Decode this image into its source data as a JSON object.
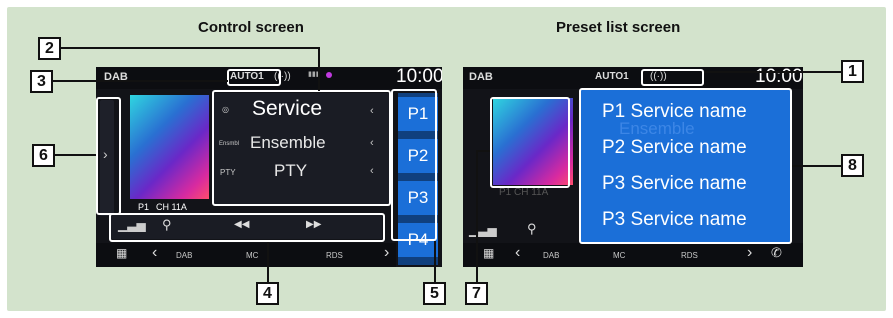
{
  "headings": {
    "left": "Control screen",
    "right": "Preset list screen"
  },
  "control": {
    "source": "DAB",
    "auto_badge": "AUTO1",
    "clock": "10:00",
    "channel_preset": "P1",
    "channel": "CH 11A",
    "info": {
      "service": "Service",
      "ensemble": "Ensemble",
      "pty": "PTY",
      "ensemble_tag": "Ensmbl",
      "pty_tag": "PTY"
    },
    "presets": [
      "P1",
      "P2",
      "P3",
      "P4"
    ],
    "dock": {
      "left": "DAB",
      "mid": "MC",
      "right": "RDS"
    }
  },
  "preset_list": {
    "source": "DAB",
    "auto_badge": "AUTO1",
    "clock": "10:00",
    "channel": "P1  CH 11A",
    "items": [
      {
        "preset": "P1",
        "name": "Service name"
      },
      {
        "preset": "P2",
        "name": "Service name"
      },
      {
        "preset": "P3",
        "name": "Service name"
      },
      {
        "preset": "P3",
        "name": "Service name"
      }
    ],
    "ghost_text": "Ensemble",
    "dock": {
      "left": "DAB",
      "mid": "MC",
      "right": "RDS"
    }
  },
  "callouts": [
    "1",
    "2",
    "3",
    "4",
    "5",
    "6",
    "7",
    "8"
  ],
  "colors": {
    "background": "#d3e3cc",
    "screen": "#121318",
    "preset_blue": "#1b6fd8",
    "highlight": "#ffffff"
  }
}
